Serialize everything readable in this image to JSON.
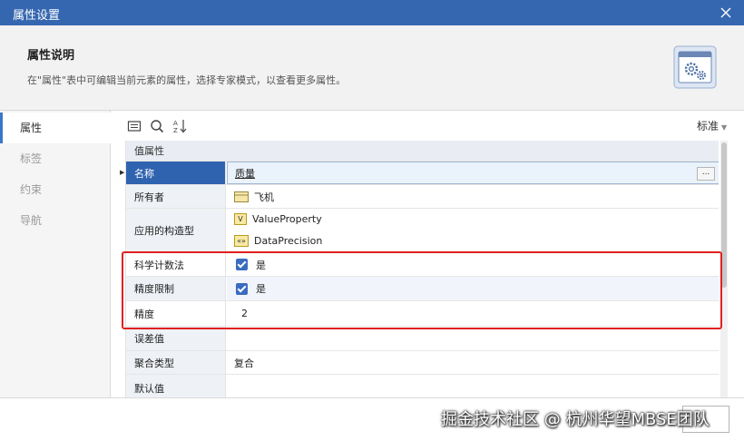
{
  "window": {
    "title": "属性设置"
  },
  "header": {
    "title": "属性说明",
    "description": "在\"属性\"表中可编辑当前元素的属性，选择专家模式，以查看更多属性。"
  },
  "sidebar": {
    "items": [
      {
        "label": "属性",
        "active": true
      },
      {
        "label": "标签",
        "active": false
      },
      {
        "label": "约束",
        "active": false
      },
      {
        "label": "导航",
        "active": false
      }
    ]
  },
  "toolbar": {
    "icons": [
      "properties-view-icon",
      "search-icon",
      "sort-az-icon"
    ],
    "view_mode": "标准"
  },
  "grid": {
    "group_header": "值属性",
    "rows": {
      "name": {
        "label": "名称",
        "value": "质量",
        "button": "..."
      },
      "owner": {
        "label": "所有者",
        "value": "飞机"
      },
      "stereotype": {
        "label": "应用的构造型",
        "values": [
          "ValueProperty",
          "DataPrecision"
        ],
        "tag1": "V",
        "tag2": "«»"
      },
      "sci": {
        "label": "科学计数法",
        "value": "是",
        "checked": true
      },
      "precision_limit": {
        "label": "精度限制",
        "value": "是",
        "checked": true
      },
      "precision": {
        "label": "精度",
        "value": "2"
      },
      "error": {
        "label": "误差值",
        "value": ""
      },
      "aggregation": {
        "label": "聚合类型",
        "value": "复合"
      },
      "default_value": {
        "label": "默认值",
        "value": ""
      }
    }
  },
  "colors": {
    "titlebar": "#3567b0",
    "selected_row": "#2f63b0",
    "highlight_border": "#e02020",
    "checkbox": "#3a6cc0"
  },
  "watermark": "掘金技术社区 @ 杭州华望MBSE团队"
}
